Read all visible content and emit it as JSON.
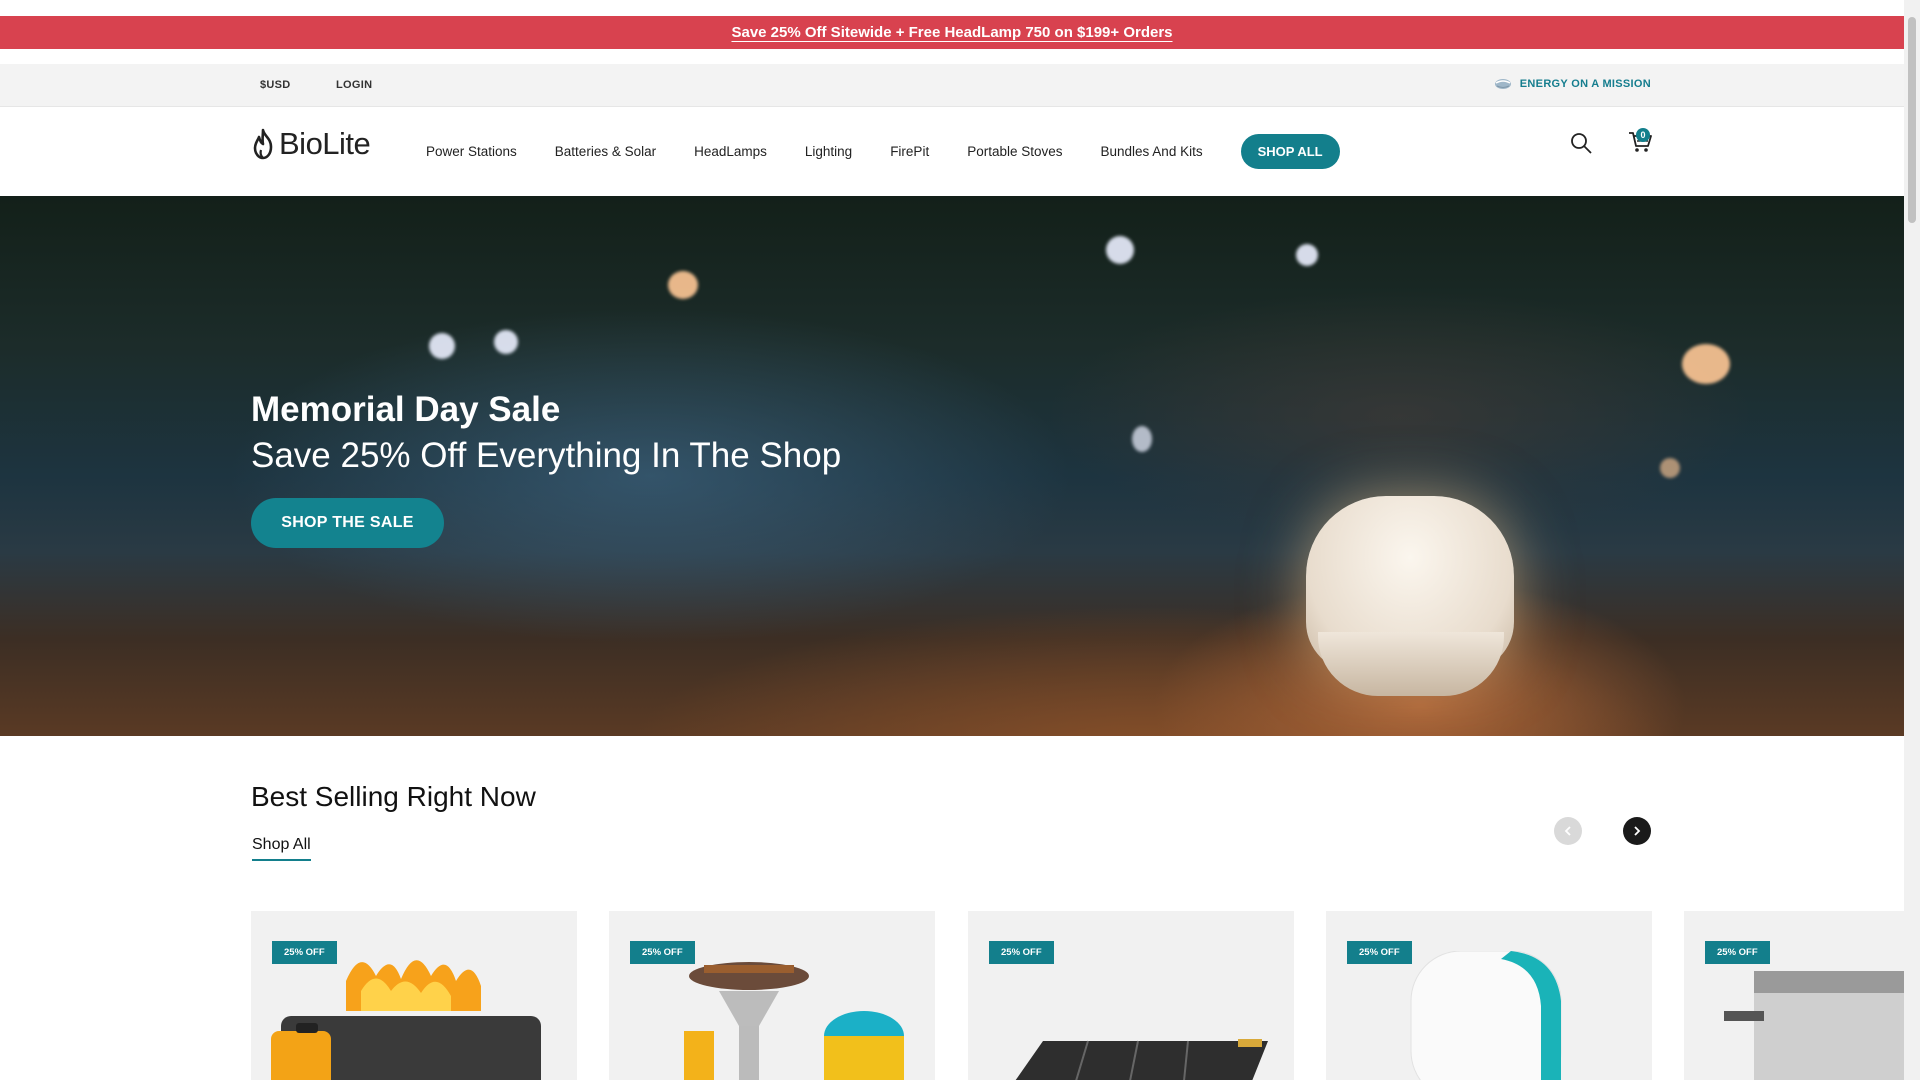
{
  "promo": {
    "text": "Save 25% Off Sitewide + Free HeadLamp 750 on $199+ Orders"
  },
  "utility": {
    "currency": "$USD",
    "login": "LOGIN",
    "mission": "ENERGY ON A MISSION"
  },
  "header": {
    "brand": "BioLite",
    "nav": [
      "Power Stations",
      "Batteries & Solar",
      "HeadLamps",
      "Lighting",
      "FirePit",
      "Portable Stoves",
      "Bundles And Kits"
    ],
    "shop_all": "SHOP ALL",
    "cart_count": "0"
  },
  "hero": {
    "title": "Memorial Day Sale",
    "subtitle": "Save 25% Off Everything In The Shop",
    "cta": "SHOP THE SALE"
  },
  "best_selling": {
    "title": "Best Selling Right Now",
    "shop_all": "Shop All",
    "cards": [
      {
        "badge": "25% OFF",
        "icon": "firepit-icon"
      },
      {
        "badge": "25% OFF",
        "icon": "camp-stove-icon"
      },
      {
        "badge": "25% OFF",
        "icon": "solar-panel-icon"
      },
      {
        "badge": "25% OFF",
        "icon": "lantern-icon"
      },
      {
        "badge": "25% OFF",
        "icon": "cookpot-icon"
      }
    ]
  },
  "colors": {
    "accent": "#137f8c",
    "promo": "#d8424f"
  }
}
